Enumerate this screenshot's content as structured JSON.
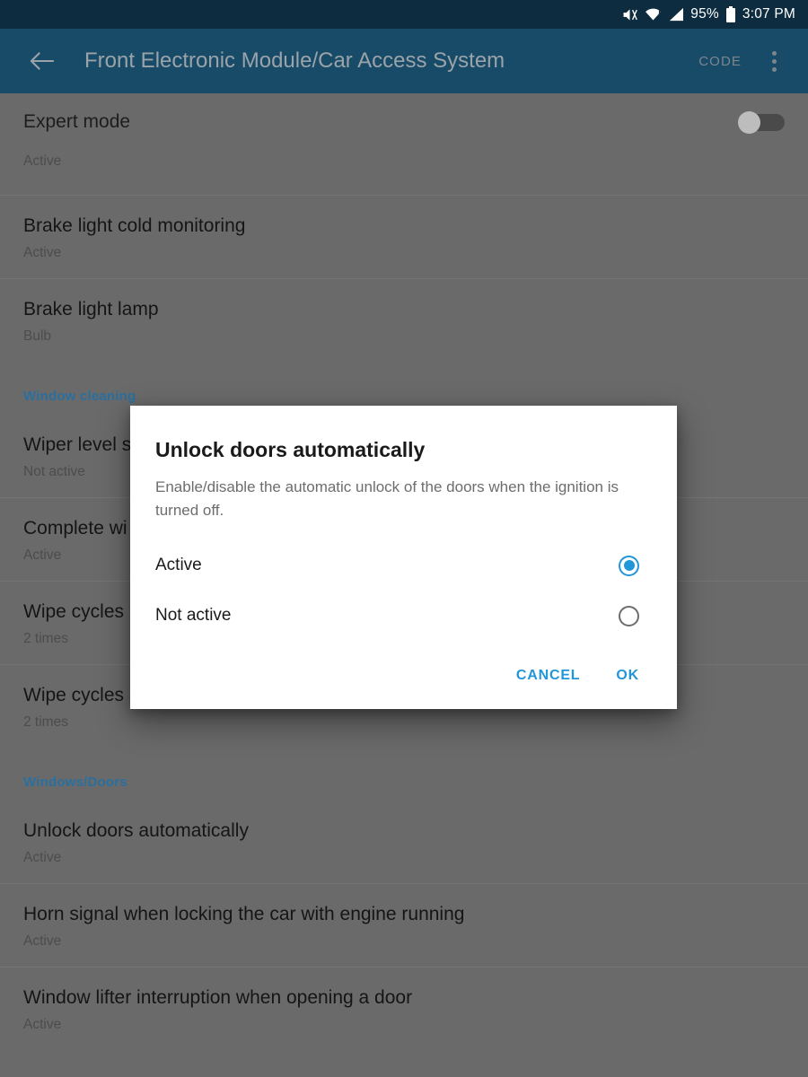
{
  "status_bar": {
    "icons": [
      "mute-icon",
      "wifi-icon",
      "cellular-signal-icon"
    ],
    "battery_percent": "95%",
    "battery_icon": "battery-icon",
    "time": "3:07 PM"
  },
  "app_bar": {
    "back_icon": "back-arrow-icon",
    "title": "Front Electronic Module/Car Access System",
    "code_label": "CODE",
    "overflow_icon": "overflow-menu-icon"
  },
  "expert_mode": {
    "label": "Expert mode",
    "toggle_state": "off"
  },
  "list": {
    "rows": [
      {
        "type": "clipped",
        "title": "",
        "subtitle": "Active"
      },
      {
        "type": "item",
        "title": "Brake light cold monitoring",
        "subtitle": "Active"
      },
      {
        "type": "item",
        "title": "Brake light lamp",
        "subtitle": "Bulb"
      },
      {
        "type": "section",
        "title": "Window cleaning"
      },
      {
        "type": "item",
        "title": "Wiper level s",
        "subtitle": "Not active"
      },
      {
        "type": "item",
        "title": "Complete wi",
        "subtitle": "Active"
      },
      {
        "type": "item",
        "title": "Wipe cycles",
        "subtitle": "2 times"
      },
      {
        "type": "item",
        "title": "Wipe cycles after rear washing",
        "subtitle": "2 times"
      },
      {
        "type": "section",
        "title": "Windows/Doors"
      },
      {
        "type": "item",
        "title": "Unlock doors automatically",
        "subtitle": "Active"
      },
      {
        "type": "item",
        "title": "Horn signal when locking the car with engine running",
        "subtitle": "Active"
      },
      {
        "type": "item",
        "title": "Window lifter interruption when opening a door",
        "subtitle": "Active"
      }
    ]
  },
  "dialog": {
    "title": "Unlock doors automatically",
    "message": "Enable/disable the automatic unlock of the doors when the ignition is turned off.",
    "options": [
      {
        "label": "Active",
        "selected": true
      },
      {
        "label": "Not active",
        "selected": false
      }
    ],
    "cancel_label": "CANCEL",
    "ok_label": "OK"
  },
  "colors": {
    "status_bar_bg": "#0e2c3f",
    "app_bar_bg": "#174b68",
    "scrim_list_bg": "#6a6a6a",
    "section_header": "#2a6f9e",
    "accent_blue": "#2196d9",
    "dialog_bg": "#ffffff"
  }
}
